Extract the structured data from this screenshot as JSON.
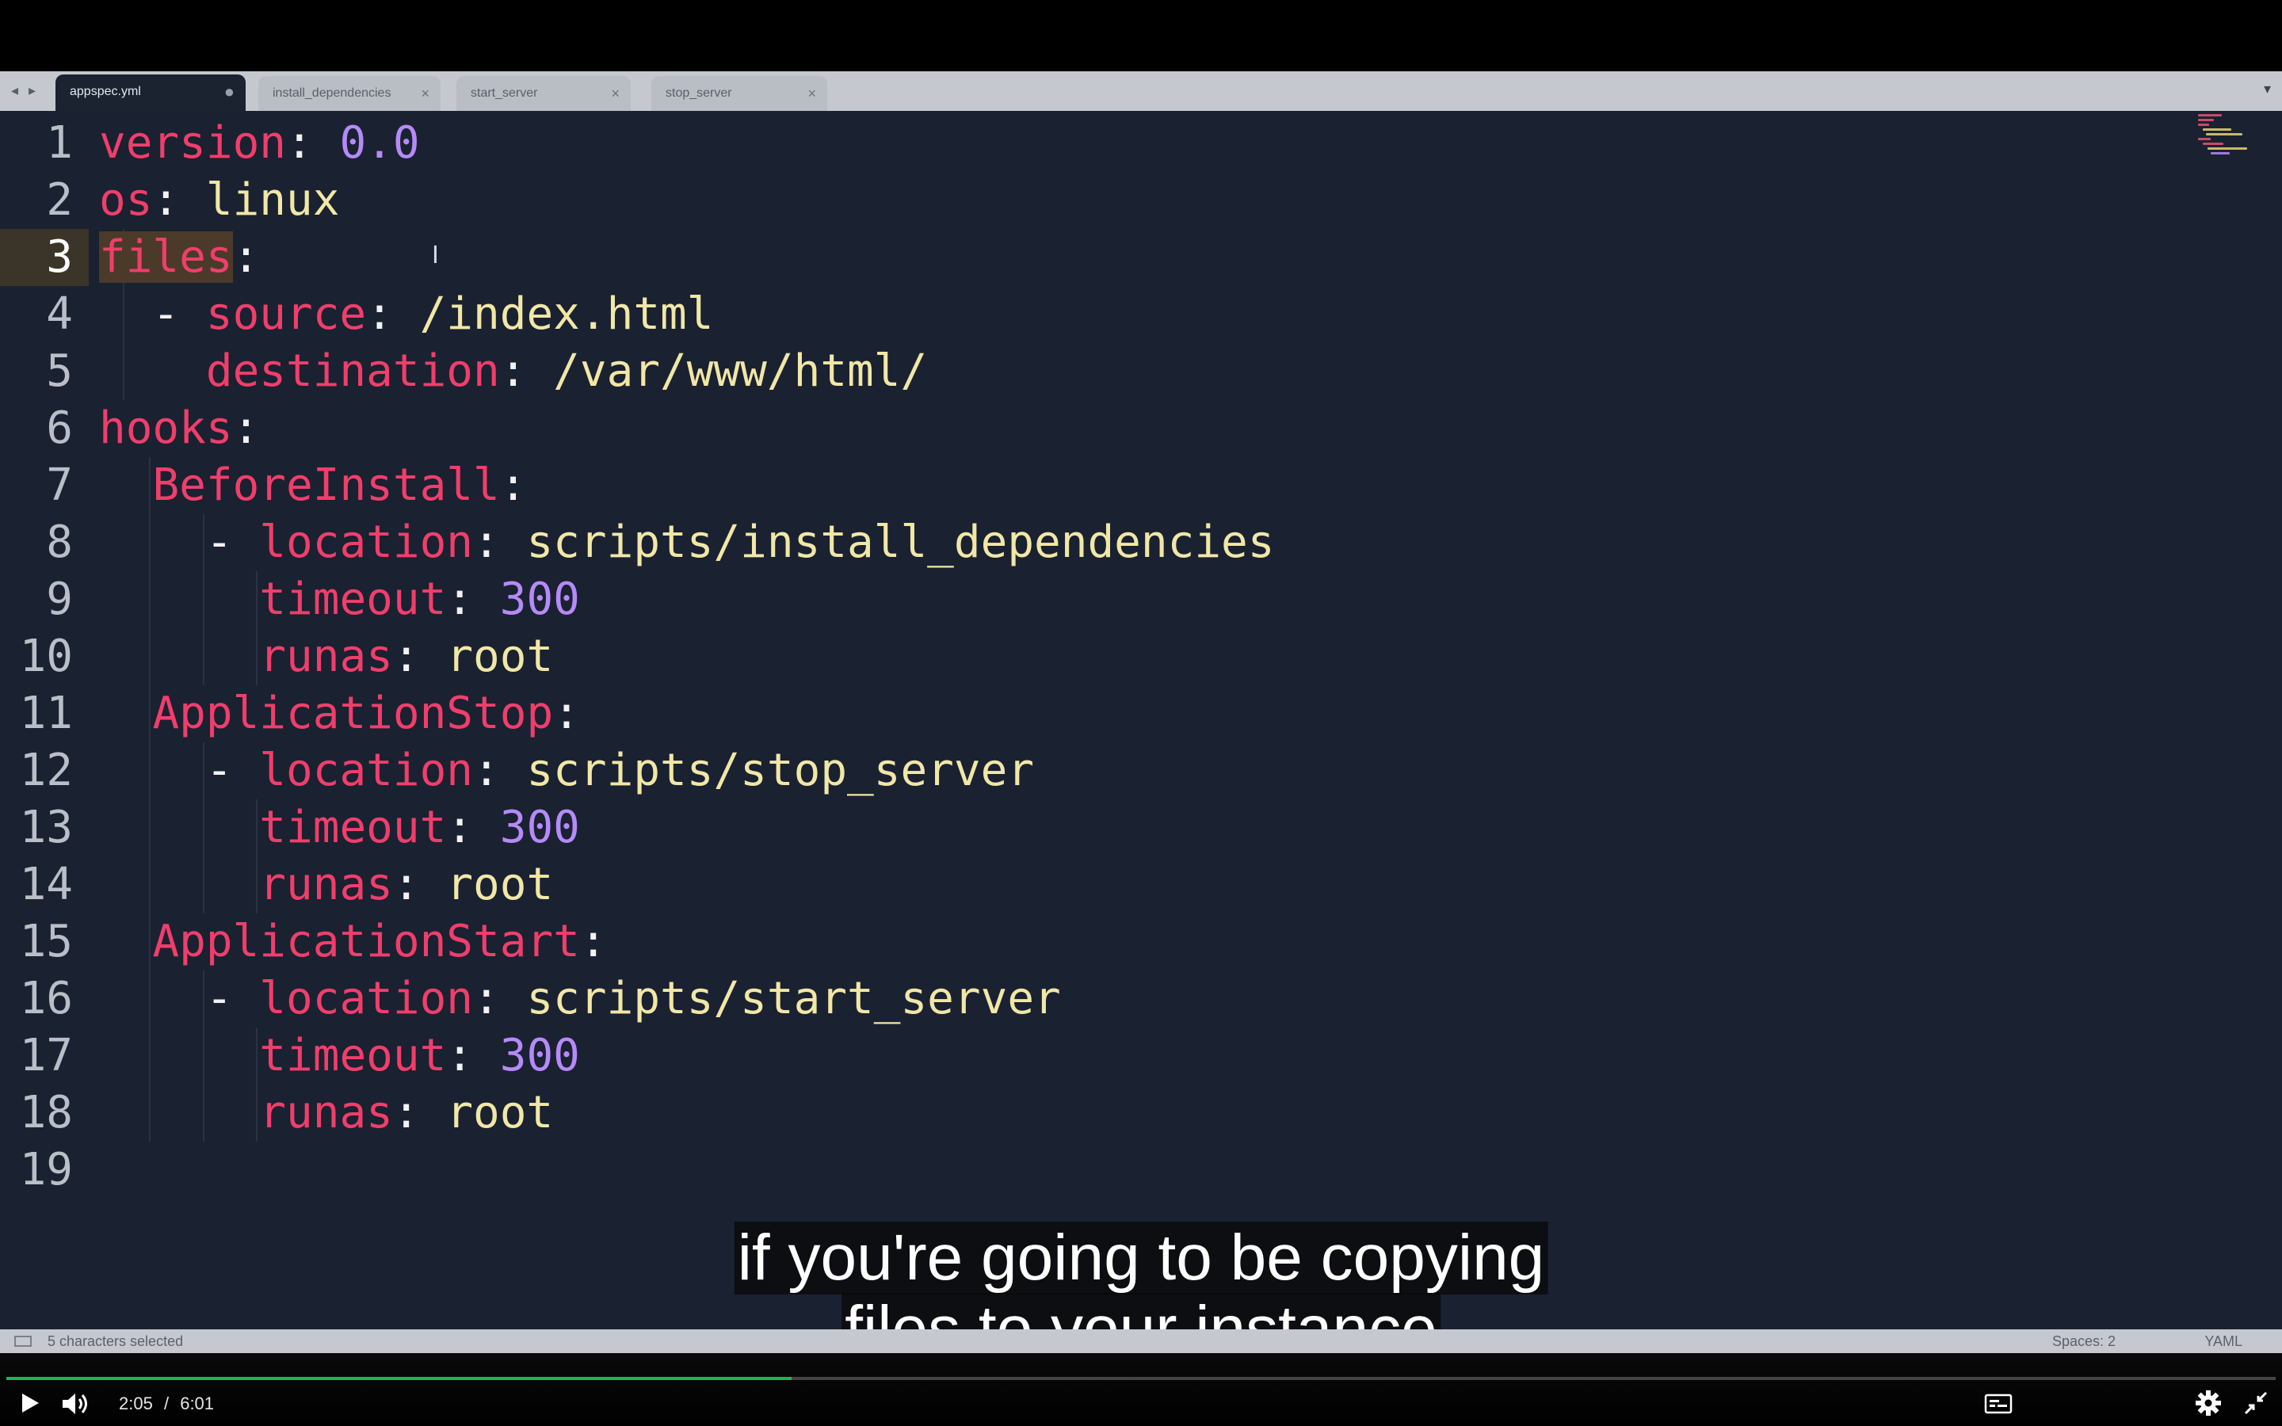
{
  "editor": {
    "tabs": [
      {
        "label": "appspec.yml",
        "active": true,
        "modified": true
      },
      {
        "label": "install_dependencies",
        "active": false
      },
      {
        "label": "start_server",
        "active": false
      },
      {
        "label": "stop_server",
        "active": false
      }
    ],
    "nav_arrows": "◂ ▸",
    "dropdown_icon": "▾",
    "close_glyph": "×",
    "modified_glyph": "●",
    "current_line": 3,
    "lines": [
      {
        "n": "1",
        "parts": [
          {
            "t": "version",
            "c": "key"
          },
          {
            "t": ": ",
            "c": "sym"
          },
          {
            "t": "0.0",
            "c": "num"
          }
        ]
      },
      {
        "n": "2",
        "parts": [
          {
            "t": "os",
            "c": "key"
          },
          {
            "t": ": ",
            "c": "sym"
          },
          {
            "t": "linux",
            "c": "str"
          }
        ]
      },
      {
        "n": "3",
        "parts": [
          {
            "t": "files",
            "c": "key sel"
          },
          {
            "t": ":",
            "c": "sym"
          }
        ]
      },
      {
        "n": "4",
        "parts": [
          {
            "t": "  - ",
            "c": "sym"
          },
          {
            "t": "source",
            "c": "key"
          },
          {
            "t": ": ",
            "c": "sym"
          },
          {
            "t": "/index.html",
            "c": "str"
          }
        ]
      },
      {
        "n": "5",
        "parts": [
          {
            "t": "    ",
            "c": "sym"
          },
          {
            "t": "destination",
            "c": "key"
          },
          {
            "t": ": ",
            "c": "sym"
          },
          {
            "t": "/var/www/html/",
            "c": "str"
          }
        ]
      },
      {
        "n": "6",
        "parts": [
          {
            "t": "hooks",
            "c": "key"
          },
          {
            "t": ":",
            "c": "sym"
          }
        ]
      },
      {
        "n": "7",
        "parts": [
          {
            "t": "  ",
            "c": "sym"
          },
          {
            "t": "BeforeInstall",
            "c": "key"
          },
          {
            "t": ":",
            "c": "sym"
          }
        ]
      },
      {
        "n": "8",
        "parts": [
          {
            "t": "    - ",
            "c": "sym"
          },
          {
            "t": "location",
            "c": "key"
          },
          {
            "t": ": ",
            "c": "sym"
          },
          {
            "t": "scripts/install_dependencies",
            "c": "str"
          }
        ]
      },
      {
        "n": "9",
        "parts": [
          {
            "t": "      ",
            "c": "sym"
          },
          {
            "t": "timeout",
            "c": "key"
          },
          {
            "t": ": ",
            "c": "sym"
          },
          {
            "t": "300",
            "c": "num"
          }
        ]
      },
      {
        "n": "10",
        "parts": [
          {
            "t": "      ",
            "c": "sym"
          },
          {
            "t": "runas",
            "c": "key"
          },
          {
            "t": ": ",
            "c": "sym"
          },
          {
            "t": "root",
            "c": "str"
          }
        ]
      },
      {
        "n": "11",
        "parts": [
          {
            "t": "  ",
            "c": "sym"
          },
          {
            "t": "ApplicationStop",
            "c": "key"
          },
          {
            "t": ":",
            "c": "sym"
          }
        ]
      },
      {
        "n": "12",
        "parts": [
          {
            "t": "    - ",
            "c": "sym"
          },
          {
            "t": "location",
            "c": "key"
          },
          {
            "t": ": ",
            "c": "sym"
          },
          {
            "t": "scripts/stop_server",
            "c": "str"
          }
        ]
      },
      {
        "n": "13",
        "parts": [
          {
            "t": "      ",
            "c": "sym"
          },
          {
            "t": "timeout",
            "c": "key"
          },
          {
            "t": ": ",
            "c": "sym"
          },
          {
            "t": "300",
            "c": "num"
          }
        ]
      },
      {
        "n": "14",
        "parts": [
          {
            "t": "      ",
            "c": "sym"
          },
          {
            "t": "runas",
            "c": "key"
          },
          {
            "t": ": ",
            "c": "sym"
          },
          {
            "t": "root",
            "c": "str"
          }
        ]
      },
      {
        "n": "15",
        "parts": [
          {
            "t": "  ",
            "c": "sym"
          },
          {
            "t": "ApplicationStart",
            "c": "key"
          },
          {
            "t": ":",
            "c": "sym"
          }
        ]
      },
      {
        "n": "16",
        "parts": [
          {
            "t": "    - ",
            "c": "sym"
          },
          {
            "t": "location",
            "c": "key"
          },
          {
            "t": ": ",
            "c": "sym"
          },
          {
            "t": "scripts/start_server",
            "c": "str"
          }
        ]
      },
      {
        "n": "17",
        "parts": [
          {
            "t": "      ",
            "c": "sym"
          },
          {
            "t": "timeout",
            "c": "key"
          },
          {
            "t": ": ",
            "c": "sym"
          },
          {
            "t": "300",
            "c": "num"
          }
        ]
      },
      {
        "n": "18",
        "parts": [
          {
            "t": "      ",
            "c": "sym"
          },
          {
            "t": "runas",
            "c": "key"
          },
          {
            "t": ": ",
            "c": "sym"
          },
          {
            "t": "root",
            "c": "str"
          }
        ]
      },
      {
        "n": "19",
        "parts": []
      }
    ],
    "status": {
      "selection": "5 characters selected",
      "spaces": "Spaces: 2",
      "syntax": "YAML"
    },
    "colors": {
      "background": "#1a2131",
      "key": "#f03e6b",
      "string": "#f1e7a6",
      "number": "#b58af8"
    }
  },
  "subtitles": {
    "line1": "if you're going to be copying",
    "line2": "files to your instance"
  },
  "player": {
    "current_time": "2:05",
    "separator": "/",
    "duration": "6:01",
    "progress_fraction": 0.346,
    "progress_color": "#1fb35a",
    "icons": [
      "play-icon",
      "volume-icon",
      "captions-icon",
      "settings-icon",
      "exit-fullscreen-icon"
    ]
  }
}
